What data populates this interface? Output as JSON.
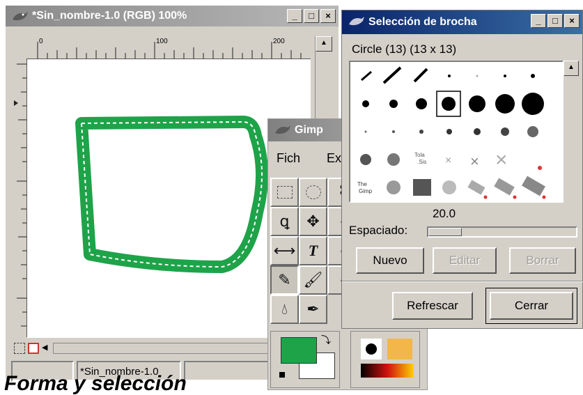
{
  "image_window": {
    "title": "*Sin_nombre-1.0 (RGB) 100%",
    "ruler_marks": [
      "0",
      "100",
      "200"
    ],
    "status_filename": "*Sin_nombre-1.0"
  },
  "toolbox": {
    "title": "Gimp",
    "menu": [
      "Fich",
      "Ex"
    ],
    "tools": [
      "rect-select",
      "ellipse-select",
      "free-select",
      "paths",
      "move",
      "flip",
      "text",
      "pencil",
      "paintbrush",
      "blur",
      "ink"
    ],
    "fg_color": "#1ea349",
    "bg_color": "#ffffff"
  },
  "brush_dialog": {
    "title": "Selección de brocha",
    "brush_name": "Circle (13) (13 x 13)",
    "spacing_value": "20.0",
    "spacing_label": "Espaciado:",
    "buttons": {
      "new": "Nuevo",
      "edit": "Editar",
      "delete": "Borrar",
      "refresh": "Refrescar",
      "close": "Cerrar"
    }
  },
  "caption": "Forma y selección",
  "accent": {
    "title_active": "#0a246a",
    "title_inactive": "#808080",
    "stroke": "#1ea349"
  }
}
